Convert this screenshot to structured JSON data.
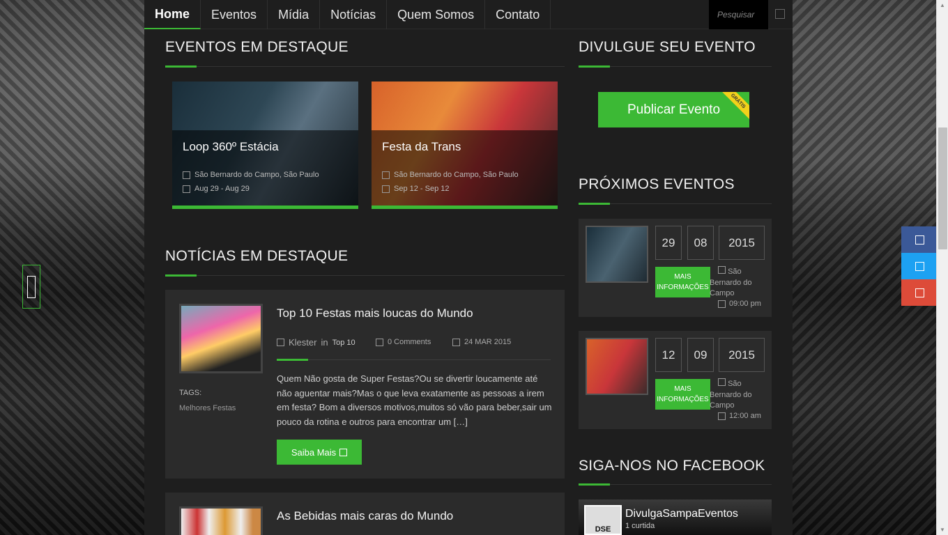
{
  "nav": {
    "items": [
      {
        "label": "Home"
      },
      {
        "label": "Eventos"
      },
      {
        "label": "Mídia"
      },
      {
        "label": "Notícias"
      },
      {
        "label": "Quem Somos"
      },
      {
        "label": "Contato"
      }
    ],
    "search_placeholder": "Pesquisar"
  },
  "featured_events": {
    "title": "EVENTOS EM DESTAQUE",
    "cards": [
      {
        "title": "Loop 360º Estácia",
        "location": "São Bernardo do Campo, São Paulo",
        "dates": "Aug 29 - Aug 29"
      },
      {
        "title": "Festa da Trans",
        "location": "São Bernardo do Campo, São Paulo",
        "dates": "Sep 12 - Sep 12"
      }
    ]
  },
  "news": {
    "title": "NOTÍCIAS EM DESTAQUE",
    "items": [
      {
        "title": "Top 10 Festas mais loucas do Mundo",
        "author": "Klester",
        "in_word": "in",
        "category": "Top 10",
        "comments": "0 Comments",
        "date": "24 MAR 2015",
        "tags_label": "TAGS:",
        "tag": "Melhores Festas",
        "excerpt": "Quem Não gosta de Super Festas?Ou se divertir loucamente até não aguentar mais?Mas o que leva exatamente as pessoas a irem em festa? Bom a diversos motivos,muitos só vão para beber,sair um pouco da rotina e outros para encontrar um […]",
        "button": "Saiba Mais"
      },
      {
        "title": "As Bebidas mais caras do Mundo"
      }
    ]
  },
  "sidebar": {
    "publish_title": "DIVULGUE SEU EVENTO",
    "publish_button": "Publicar Evento",
    "publish_ribbon": "GRÁTIS",
    "upcoming_title": "PRÓXIMOS EVENTOS",
    "upcoming": [
      {
        "day": "29",
        "month": "08",
        "year": "2015",
        "button": "MAIS INFORMAÇÕES",
        "location": "São Bernardo do Campo",
        "time": "09:00 pm"
      },
      {
        "day": "12",
        "month": "09",
        "year": "2015",
        "button": "MAIS INFORMAÇÕES",
        "location": "São Bernardo do Campo",
        "time": "12:00 am"
      }
    ],
    "facebook_title": "SIGA-NOS NO FACEBOOK",
    "facebook": {
      "page_name": "DivulgaSampaEventos",
      "likes": "1 curtida",
      "logo_text": "DSE"
    }
  },
  "colors": {
    "accent": "#3cb935",
    "facebook_share": "#3b5998",
    "twitter_share": "#1da1f2",
    "google_share": "#dd4b39"
  }
}
